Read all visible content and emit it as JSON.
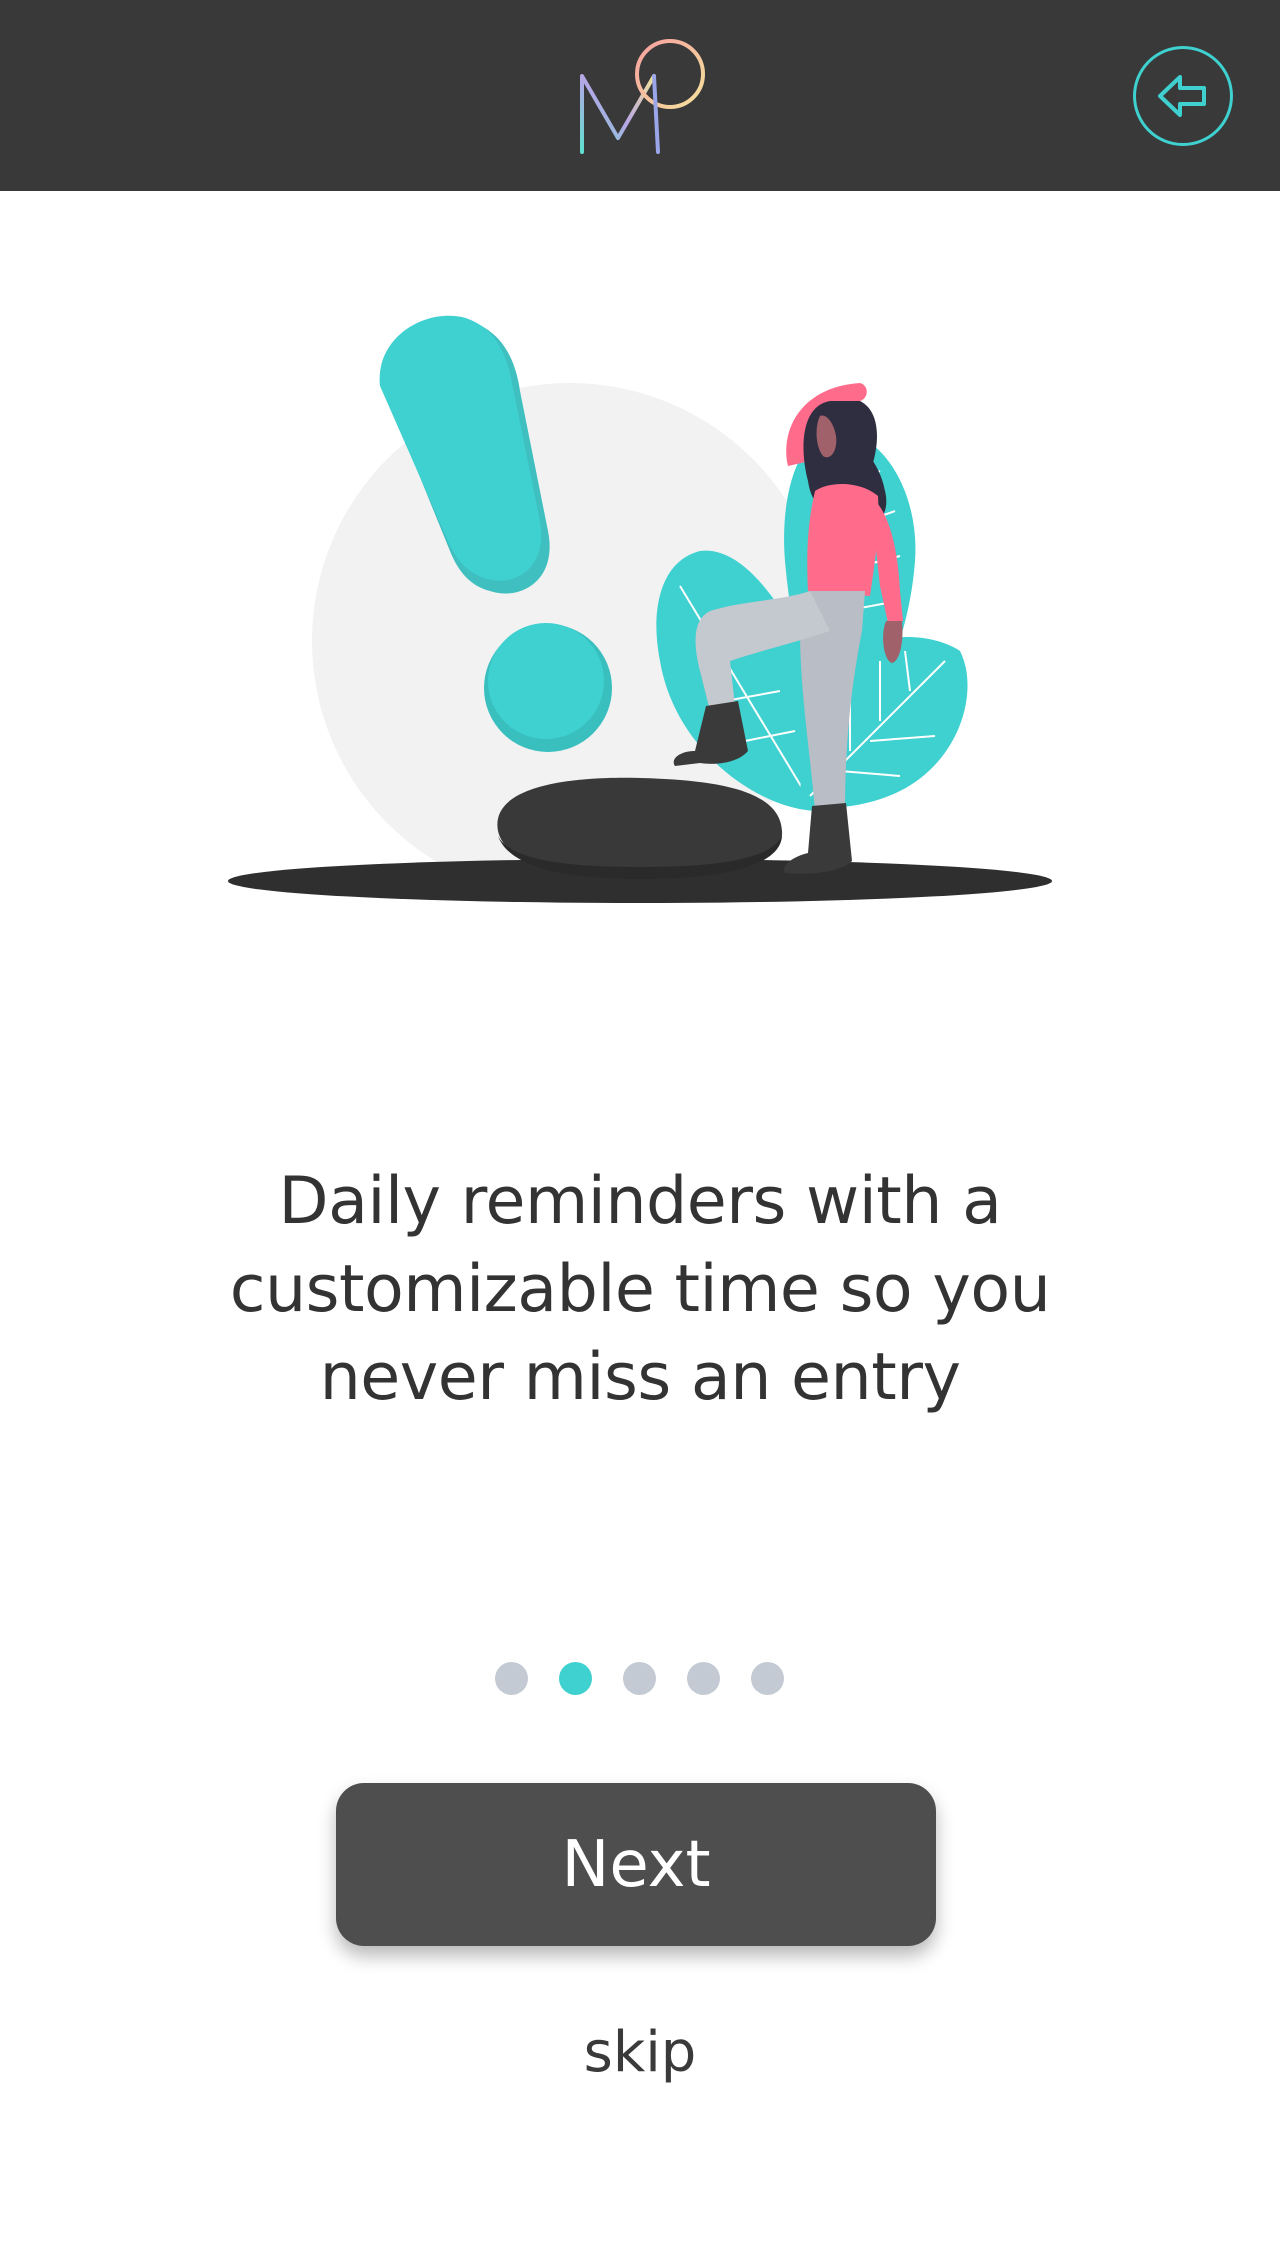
{
  "header": {
    "logo_icon": "mind-logo-icon",
    "back_icon": "arrow-left-circle-icon",
    "accent_color": "#3fd0d0",
    "bar_color": "#393939"
  },
  "illustration": {
    "name": "reminder-illustration",
    "accent_color": "#3fd0d0",
    "figure_shirt_color": "#ff6b8b"
  },
  "onboarding": {
    "message": "Daily reminders with a customizable time so you never miss an entry",
    "current_step": 2,
    "total_steps": 5
  },
  "pagination": {
    "active_color": "#3fd0d0",
    "inactive_color": "#c4cad3"
  },
  "actions": {
    "next_label": "Next",
    "skip_label": "skip"
  }
}
